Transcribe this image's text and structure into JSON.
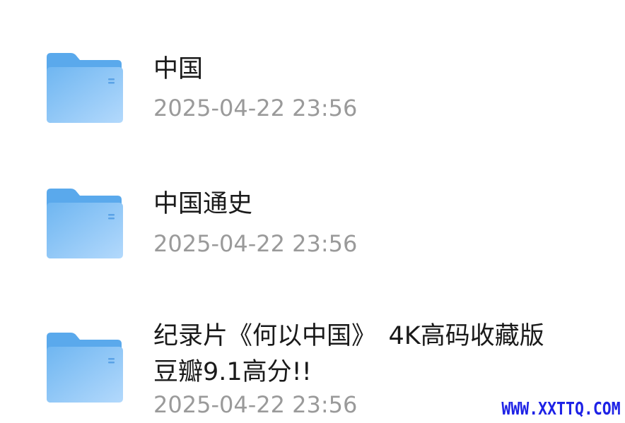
{
  "files": [
    {
      "name": "中国",
      "date": "2025-04-22 23:56",
      "icon": "folder-icon"
    },
    {
      "name": "中国通史",
      "date": "2025-04-22 23:56",
      "icon": "folder-icon"
    },
    {
      "name_line1": "纪录片《何以中国》　4K高码收藏版",
      "name_line2": "豆瓣9.1高分!!",
      "date": "2025-04-22 23:56",
      "icon": "folder-icon"
    }
  ],
  "watermark": "WWW.XXTTQ.COM",
  "colors": {
    "folder_back": "#5aa9ec",
    "folder_front_light": "#a9d3fb",
    "folder_front_dark": "#6fb6f1",
    "name_text": "#1a1a1a",
    "date_text": "#9a9a9a",
    "watermark": "#1e22e6"
  }
}
